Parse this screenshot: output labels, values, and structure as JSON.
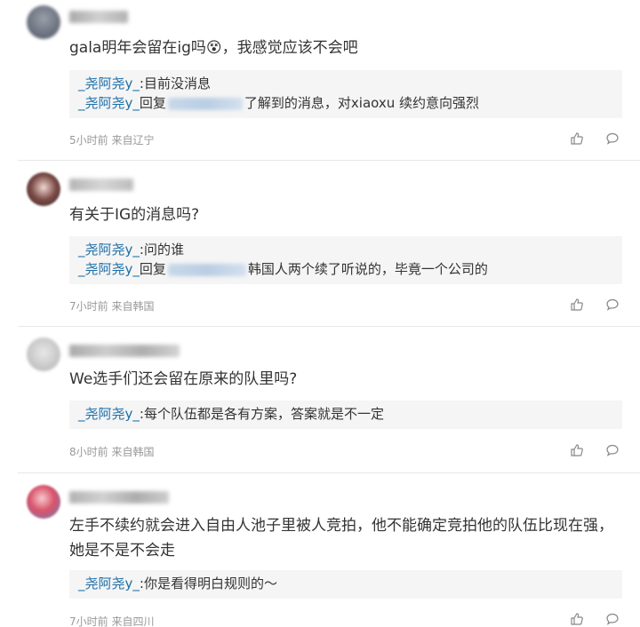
{
  "comments": [
    {
      "content": "gala明年会留在ig吗😵，我感觉应该不会吧",
      "replies": [
        {
          "user": "_尧阿尧y_",
          "sep": ":",
          "text": "目前没消息",
          "reply_to": false
        },
        {
          "user": "_尧阿尧y_",
          "sep": "回复",
          "text": "了解到的消息，对xiaoxu 续约意向强烈",
          "reply_to": true
        }
      ],
      "meta": "5小时前 来自辽宁"
    },
    {
      "content": "有关于IG的消息吗?",
      "replies": [
        {
          "user": "_尧阿尧y_",
          "sep": ":",
          "text": "问的谁",
          "reply_to": false
        },
        {
          "user": "_尧阿尧y_",
          "sep": "回复",
          "text": "韩国人两个续了听说的，毕竟一个公司的",
          "reply_to": true
        }
      ],
      "meta": "7小时前 来自韩国"
    },
    {
      "content": "We选手们还会留在原来的队里吗?",
      "replies": [
        {
          "user": "_尧阿尧y_",
          "sep": ":",
          "text": "每个队伍都是各有方案，答案就是不一定",
          "reply_to": false
        }
      ],
      "meta": "8小时前 来自韩国"
    },
    {
      "content": "左手不续约就会进入自由人池子里被人竞拍，他不能确定竞拍他的队伍比现在强，她是不是不会走",
      "replies": [
        {
          "user": "_尧阿尧y_",
          "sep": ":",
          "text": "你是看得明白规则的～",
          "reply_to": false
        }
      ],
      "meta": "7小时前 来自四川"
    }
  ],
  "icons": {
    "like": "thumbs-up-icon",
    "comment": "comment-bubble-icon"
  },
  "colors": {
    "link": "#1c6ea8",
    "reply_bg": "#f5f5f5",
    "meta": "#999999",
    "divider": "#e8e8e8"
  }
}
